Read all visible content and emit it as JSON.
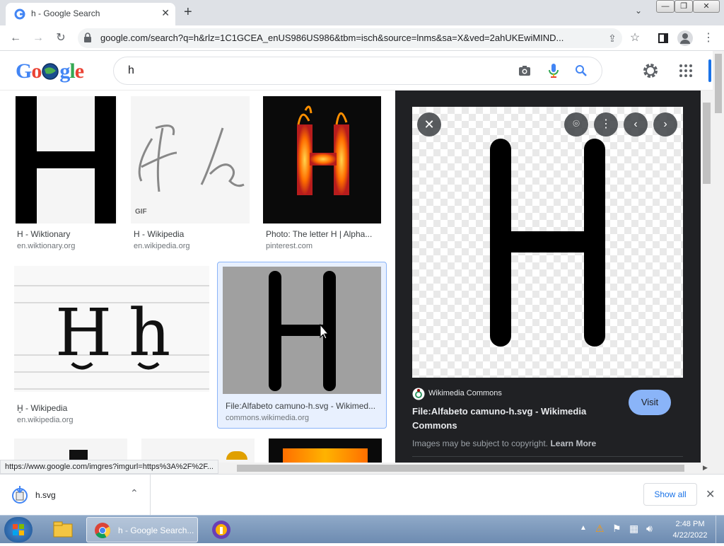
{
  "browser": {
    "tab_title": "h - Google Search",
    "tab_close": "✕",
    "new_tab": "+",
    "tab_menu": "⌄",
    "url": "google.com/search?q=h&rlz=1C1GCEA_enUS986US986&tbm=isch&source=lnms&sa=X&ved=2ahUKEwiMIND...",
    "status_url": "https://www.google.com/imgres?imgurl=https%3A%2F%2F..."
  },
  "google": {
    "query": "h"
  },
  "results": [
    {
      "title": "H - Wiktionary",
      "source": "en.wiktionary.org"
    },
    {
      "title": "H - Wikipedia",
      "source": "en.wikipedia.org",
      "badge": "GIF"
    },
    {
      "title": "Photo: The letter H | Alpha...",
      "source": "pinterest.com"
    },
    {
      "title": "Ḫ - Wikipedia",
      "source": "en.wikipedia.org"
    },
    {
      "title": "File:Alfabeto camuno-h.svg - Wikimed...",
      "source": "commons.wikimedia.org"
    }
  ],
  "preview": {
    "site": "Wikimedia Commons",
    "title": "File:Alfabeto camuno-h.svg - Wikimedia Commons",
    "visit": "Visit",
    "copyright": "Images may be subject to copyright.",
    "learn_more": "Learn More"
  },
  "downloads": {
    "file": "h.svg",
    "show_all": "Show all"
  },
  "taskbar": {
    "chrome_label": "h - Google Search...",
    "time": "2:48 PM",
    "date": "4/22/2022"
  },
  "colors": {
    "accent_blue": "#1a73e8",
    "panel_bg": "#202124",
    "visit_btn": "#8ab4f8"
  }
}
